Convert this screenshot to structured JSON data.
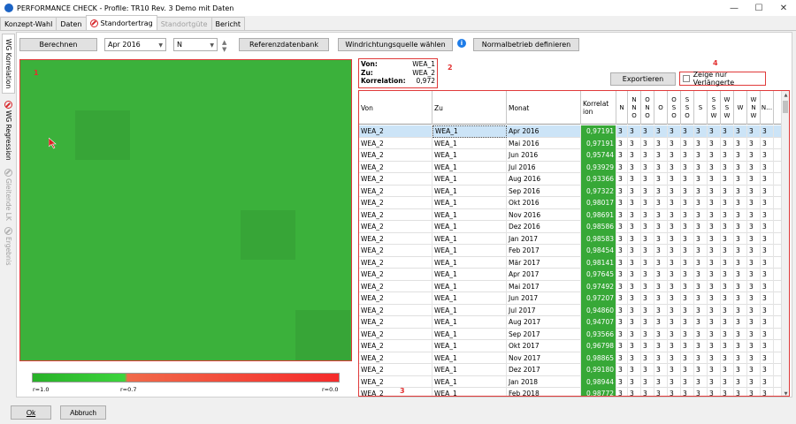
{
  "window": {
    "title": "PERFORMANCE CHECK - Profile: TR10 Rev. 3 Demo mit Daten",
    "minimize": "—",
    "maximize": "☐",
    "close": "✕"
  },
  "tabs": [
    {
      "label": "Konzept-Wahl",
      "state": "normal"
    },
    {
      "label": "Daten",
      "state": "normal"
    },
    {
      "label": "Standortertrag",
      "state": "active"
    },
    {
      "label": "Standortgüte",
      "state": "disabled"
    },
    {
      "label": "Bericht",
      "state": "normal"
    }
  ],
  "side_tabs": [
    {
      "label": "WG Korrelation",
      "state": "active"
    },
    {
      "label": "WG Regression",
      "state": "normal"
    },
    {
      "label": "Gleitende LK",
      "state": "disabled"
    },
    {
      "label": "Ergebnis",
      "state": "disabled"
    }
  ],
  "toolbar": {
    "calc_label": "Berechnen",
    "month_value": "Apr 2016",
    "direction_value": "N",
    "refdb_label": "Referenzdatenbank",
    "wind_source_label": "Windrichtungsquelle wählen",
    "info_label": "i",
    "normal_label": "Normalbetrieb definieren"
  },
  "annotations": {
    "a1": "1",
    "a2": "2",
    "a3": "3",
    "a4": "4"
  },
  "info": {
    "von_label": "Von:",
    "von_value": "WEA_1",
    "zu_label": "Zu:",
    "zu_value": "WEA_2",
    "korr_label": "Korrelation:",
    "korr_value": "0,972"
  },
  "export_label": "Exportieren",
  "extend_label": "Zeige nur Verlängerte",
  "colorbar": {
    "left": "r=1.0",
    "mid": "r=0.7",
    "right": "r=0.0"
  },
  "heatmap": {
    "grid": 6,
    "colors": {
      "base": "#3bb13b",
      "dark": "#37a537"
    },
    "dark_cells": [
      [
        1,
        1
      ],
      [
        3,
        4
      ],
      [
        5,
        5
      ]
    ]
  },
  "table": {
    "headers": [
      "Von",
      "Zu",
      "Monat",
      "Korrelat\nion",
      "N",
      "N\nN\nO",
      "O\nN\nO",
      "O",
      "O\nS\nO",
      "S\nS\nO",
      "S",
      "S\nS\nW",
      "W\nS\nW",
      "W",
      "W\nN\nW",
      "N…"
    ],
    "rows": [
      {
        "von": "WEA_2",
        "zu": "WEA_1",
        "monat": "Apr 2016",
        "korr": "0,97191"
      },
      {
        "von": "WEA_2",
        "zu": "WEA_1",
        "monat": "Mai 2016",
        "korr": "0,97191"
      },
      {
        "von": "WEA_2",
        "zu": "WEA_1",
        "monat": "Jun 2016",
        "korr": "0,95744"
      },
      {
        "von": "WEA_2",
        "zu": "WEA_1",
        "monat": "Jul 2016",
        "korr": "0,93929"
      },
      {
        "von": "WEA_2",
        "zu": "WEA_1",
        "monat": "Aug 2016",
        "korr": "0,93366"
      },
      {
        "von": "WEA_2",
        "zu": "WEA_1",
        "monat": "Sep 2016",
        "korr": "0,97322"
      },
      {
        "von": "WEA_2",
        "zu": "WEA_1",
        "monat": "Okt 2016",
        "korr": "0,98017"
      },
      {
        "von": "WEA_2",
        "zu": "WEA_1",
        "monat": "Nov 2016",
        "korr": "0,98691"
      },
      {
        "von": "WEA_2",
        "zu": "WEA_1",
        "monat": "Dez 2016",
        "korr": "0,98586"
      },
      {
        "von": "WEA_2",
        "zu": "WEA_1",
        "monat": "Jan 2017",
        "korr": "0,98583"
      },
      {
        "von": "WEA_2",
        "zu": "WEA_1",
        "monat": "Feb 2017",
        "korr": "0,98454"
      },
      {
        "von": "WEA_2",
        "zu": "WEA_1",
        "monat": "Mär 2017",
        "korr": "0,98141"
      },
      {
        "von": "WEA_2",
        "zu": "WEA_1",
        "monat": "Apr 2017",
        "korr": "0,97645"
      },
      {
        "von": "WEA_2",
        "zu": "WEA_1",
        "monat": "Mai 2017",
        "korr": "0,97492"
      },
      {
        "von": "WEA_2",
        "zu": "WEA_1",
        "monat": "Jun 2017",
        "korr": "0,97207"
      },
      {
        "von": "WEA_2",
        "zu": "WEA_1",
        "monat": "Jul 2017",
        "korr": "0,94860"
      },
      {
        "von": "WEA_2",
        "zu": "WEA_1",
        "monat": "Aug 2017",
        "korr": "0,94707"
      },
      {
        "von": "WEA_2",
        "zu": "WEA_1",
        "monat": "Sep 2017",
        "korr": "0,93566"
      },
      {
        "von": "WEA_2",
        "zu": "WEA_1",
        "monat": "Okt 2017",
        "korr": "0,96798"
      },
      {
        "von": "WEA_2",
        "zu": "WEA_1",
        "monat": "Nov 2017",
        "korr": "0,98865"
      },
      {
        "von": "WEA_2",
        "zu": "WEA_1",
        "monat": "Dez 2017",
        "korr": "0,99180"
      },
      {
        "von": "WEA_2",
        "zu": "WEA_1",
        "monat": "Jan 2018",
        "korr": "0,98944"
      },
      {
        "von": "WEA_2",
        "zu": "WEA_1",
        "monat": "Feb 2018",
        "korr": "0,98772"
      }
    ],
    "dir_value": "3"
  },
  "footer": {
    "ok_label": "Ok",
    "cancel_label": "Abbruch"
  }
}
